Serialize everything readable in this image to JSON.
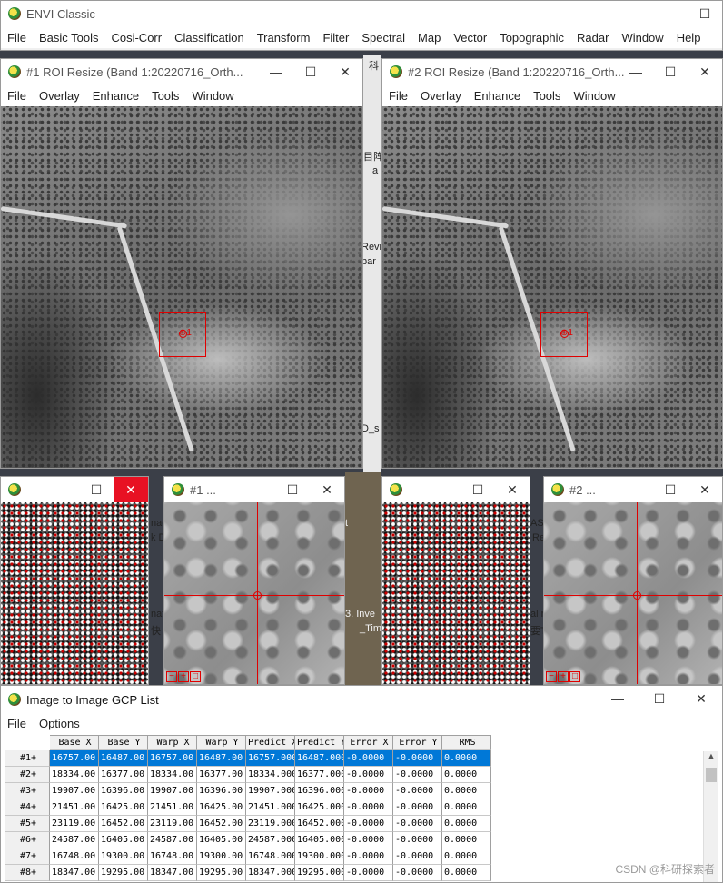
{
  "main": {
    "title": "ENVI Classic",
    "menu": [
      "File",
      "Basic Tools",
      "Cosi-Corr",
      "Classification",
      "Transform",
      "Filter",
      "Spectral",
      "Map",
      "Vector",
      "Topographic",
      "Radar",
      "Window",
      "Help"
    ]
  },
  "display1": {
    "title": "#1 ROI Resize (Band 1:20220716_Orth...",
    "menu": [
      "File",
      "Overlay",
      "Enhance",
      "Tools",
      "Window"
    ],
    "gcp_label": "⊕1"
  },
  "display2": {
    "title": "#2 ROI Resize (Band 1:20220716_Orth...",
    "menu": [
      "File",
      "Overlay",
      "Enhance",
      "Tools",
      "Window"
    ],
    "gcp_label": "⊕1"
  },
  "zoom1": {
    "title": "#1 ..."
  },
  "zoom2": {
    "title": "#2 ..."
  },
  "desktop_text": {
    "t1": "科",
    "t2": "目阵",
    "t3": "a",
    "t4": "Revi",
    "t5": "bar",
    "t6": "D_s",
    "t7": "nag",
    "t8": "k D",
    "t9": "nat",
    "t10": "快",
    "t11": "3.  Inve",
    "t12": "_Tim",
    "t13": "AS_",
    "t14": "Re",
    "t15": "al r",
    "t16": "要T",
    "t17": "t"
  },
  "gcp": {
    "title": "Image to Image GCP List",
    "menu": [
      "File",
      "Options"
    ],
    "columns": [
      "Base X",
      "Base Y",
      "Warp X",
      "Warp Y",
      "Predict X",
      "Predict Y",
      "Error X",
      "Error Y",
      "RMS"
    ],
    "rows": [
      {
        "label": "#1+",
        "cells": [
          "16757.00",
          "16487.00",
          "16757.00",
          "16487.00",
          "16757.000",
          "16487.000",
          "-0.0000",
          "-0.0000",
          "0.0000"
        ]
      },
      {
        "label": "#2+",
        "cells": [
          "18334.00",
          "16377.00",
          "18334.00",
          "16377.00",
          "18334.000",
          "16377.000",
          "-0.0000",
          "-0.0000",
          "0.0000"
        ]
      },
      {
        "label": "#3+",
        "cells": [
          "19907.00",
          "16396.00",
          "19907.00",
          "16396.00",
          "19907.000",
          "16396.000",
          "-0.0000",
          "-0.0000",
          "0.0000"
        ]
      },
      {
        "label": "#4+",
        "cells": [
          "21451.00",
          "16425.00",
          "21451.00",
          "16425.00",
          "21451.000",
          "16425.000",
          "-0.0000",
          "-0.0000",
          "0.0000"
        ]
      },
      {
        "label": "#5+",
        "cells": [
          "23119.00",
          "16452.00",
          "23119.00",
          "16452.00",
          "23119.000",
          "16452.000",
          "-0.0000",
          "-0.0000",
          "0.0000"
        ]
      },
      {
        "label": "#6+",
        "cells": [
          "24587.00",
          "16405.00",
          "24587.00",
          "16405.00",
          "24587.000",
          "16405.000",
          "-0.0000",
          "-0.0000",
          "0.0000"
        ]
      },
      {
        "label": "#7+",
        "cells": [
          "16748.00",
          "19300.00",
          "16748.00",
          "19300.00",
          "16748.000",
          "19300.000",
          "-0.0000",
          "-0.0000",
          "0.0000"
        ]
      },
      {
        "label": "#8+",
        "cells": [
          "18347.00",
          "19295.00",
          "18347.00",
          "19295.00",
          "18347.000",
          "19295.000",
          "-0.0000",
          "-0.0000",
          "0.0000"
        ]
      }
    ],
    "selected_row": 0
  },
  "watermark": "CSDN @科研探索者",
  "icons": {
    "app": "envi-globe-icon",
    "minimize": "minimize-icon",
    "maximize": "maximize-icon",
    "close": "close-icon"
  }
}
